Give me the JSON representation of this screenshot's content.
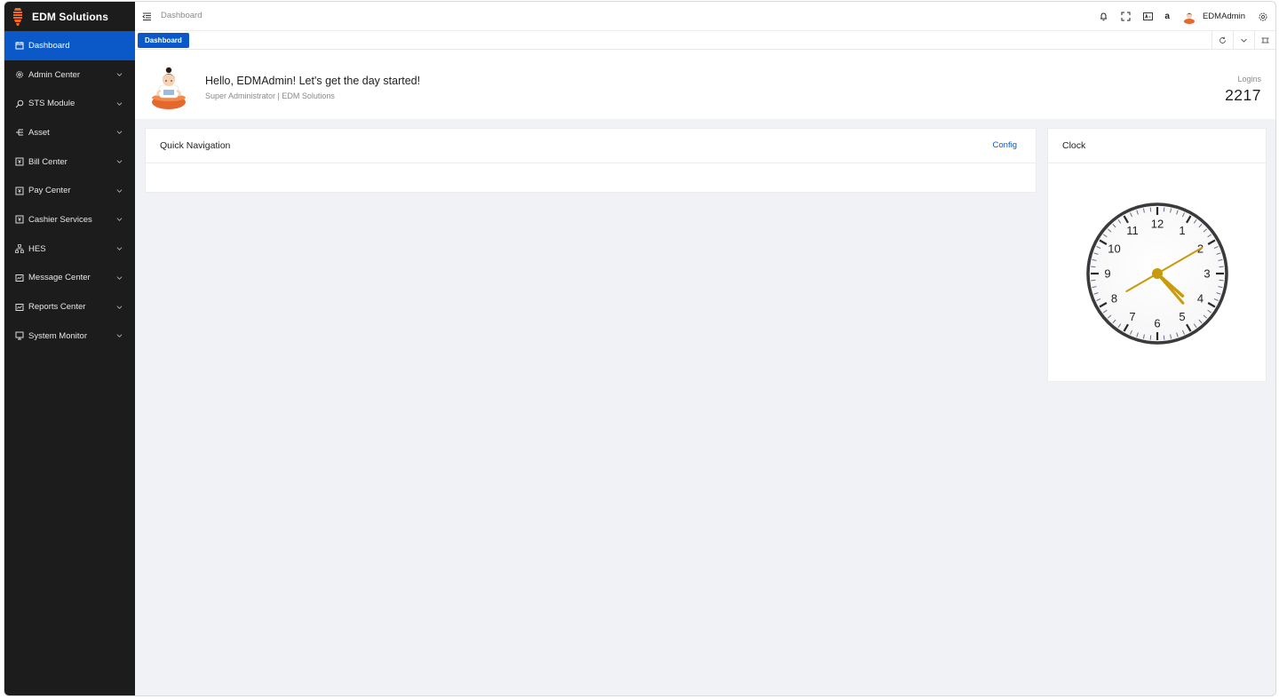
{
  "app": {
    "name": "EDM Solutions"
  },
  "sidebar": {
    "items": [
      {
        "label": "Dashboard",
        "icon": "calendar-icon",
        "active": true
      },
      {
        "label": "Admin Center",
        "icon": "gear-icon"
      },
      {
        "label": "STS Module",
        "icon": "search-key-icon"
      },
      {
        "label": "Asset",
        "icon": "tree-icon"
      },
      {
        "label": "Bill Center",
        "icon": "bill-icon"
      },
      {
        "label": "Pay Center",
        "icon": "pay-icon"
      },
      {
        "label": "Cashier Services",
        "icon": "cashier-icon"
      },
      {
        "label": "HES",
        "icon": "network-icon"
      },
      {
        "label": "Message Center",
        "icon": "message-icon"
      },
      {
        "label": "Reports Center",
        "icon": "chart-icon"
      },
      {
        "label": "System Monitor",
        "icon": "monitor-icon"
      }
    ]
  },
  "header": {
    "breadcrumb": "Dashboard",
    "amazon_glyph": "a",
    "username": "EDMAdmin"
  },
  "tabs": [
    {
      "label": "Dashboard",
      "active": true
    }
  ],
  "welcome": {
    "greeting": "Hello, EDMAdmin! Let's get the day started!",
    "subtitle": "Super Administrator | EDM Solutions",
    "logins_label": "Logins",
    "logins_value": "2217"
  },
  "quick_nav": {
    "title": "Quick Navigation",
    "config_label": "Config"
  },
  "clock": {
    "title": "Clock",
    "numbers": [
      "12",
      "1",
      "2",
      "3",
      "4",
      "5",
      "6",
      "7",
      "8",
      "9",
      "10",
      "11"
    ],
    "hour": 4,
    "minute": 23,
    "second": 10
  },
  "colors": {
    "accent": "#0b59c8",
    "sidebar_bg": "#1c1c1c",
    "page_bg": "#f0f2f5",
    "clock_hand": "#c99a0c",
    "brand_logo": "#f26a21"
  }
}
